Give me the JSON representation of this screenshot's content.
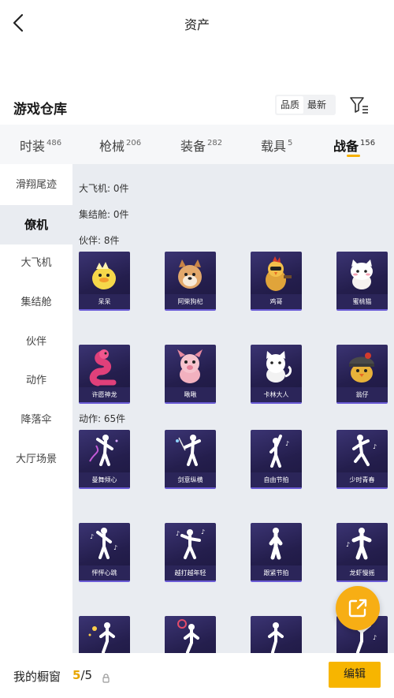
{
  "header": {
    "title": "资产"
  },
  "section": {
    "title": "游戏仓库",
    "sort_quality": "品质",
    "sort_newest": "最新"
  },
  "tabs": [
    {
      "label": "时装",
      "count": "486"
    },
    {
      "label": "枪械",
      "count": "206"
    },
    {
      "label": "装备",
      "count": "282"
    },
    {
      "label": "载具",
      "count": "5"
    },
    {
      "label": "战备",
      "count": "156"
    }
  ],
  "sidebar": [
    {
      "label": "滑翔尾迹"
    },
    {
      "label": "僚机"
    },
    {
      "label": "大飞机"
    },
    {
      "label": "集结舱"
    },
    {
      "label": "伙伴"
    },
    {
      "label": "动作"
    },
    {
      "label": "降落伞"
    },
    {
      "label": "大厅场景"
    }
  ],
  "content": {
    "group_plane": "大飞机: 0件",
    "group_pod": "集结舱: 0件",
    "group_partner": "伙伴: 8件",
    "group_emote": "动作: 65件",
    "partners": [
      {
        "name": "呆呆"
      },
      {
        "name": "阿柴狗杞"
      },
      {
        "name": "鸡哥"
      },
      {
        "name": "蜜桃猫"
      },
      {
        "name": "许愿神龙"
      },
      {
        "name": "啾啾"
      },
      {
        "name": "卡林大人"
      },
      {
        "name": "翁仔"
      }
    ],
    "emotes": [
      {
        "name": "曼舞倾心"
      },
      {
        "name": "剑意纵横"
      },
      {
        "name": "自由节拍"
      },
      {
        "name": "少时青春"
      },
      {
        "name": "怦怦心跳"
      },
      {
        "name": "越打越年轻"
      },
      {
        "name": "跟紧节拍"
      },
      {
        "name": "龙虾慢摇"
      }
    ]
  },
  "bottom": {
    "window_label": "我的橱窗",
    "window_current": "5",
    "window_total": "/5",
    "edit_label": "编辑"
  },
  "colors": {
    "accent": "#f7b500",
    "card_bg": "#2b2559",
    "content_bg": "#e9ecf1"
  }
}
